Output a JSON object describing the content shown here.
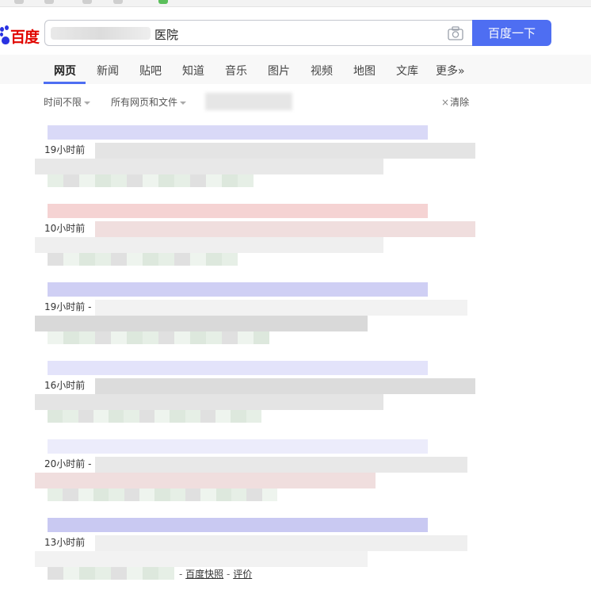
{
  "logo": {
    "text": "百度"
  },
  "search": {
    "query": "医院",
    "button_label": "百度一下"
  },
  "tabs": [
    {
      "label": "网页",
      "active": true
    },
    {
      "label": "新闻"
    },
    {
      "label": "贴吧"
    },
    {
      "label": "知道"
    },
    {
      "label": "音乐"
    },
    {
      "label": "图片"
    },
    {
      "label": "视频"
    },
    {
      "label": "地图"
    },
    {
      "label": "文库"
    },
    {
      "label": "更多»"
    }
  ],
  "filters": {
    "time": "时间不限",
    "scope": "所有网页和文件",
    "clear": "清除"
  },
  "results": [
    {
      "time": "19小时前"
    },
    {
      "time": "10小时前"
    },
    {
      "time": "19小时前 -"
    },
    {
      "time": "16小时前"
    },
    {
      "time": "20小时前 -"
    },
    {
      "time": "13小时前"
    }
  ],
  "footer_links": {
    "separator": "-",
    "cache": "百度快照",
    "review": "评价"
  },
  "colors": {
    "accent": "#4e6ef2",
    "brand_red": "#e10601",
    "brand_blue": "#2932e1"
  }
}
